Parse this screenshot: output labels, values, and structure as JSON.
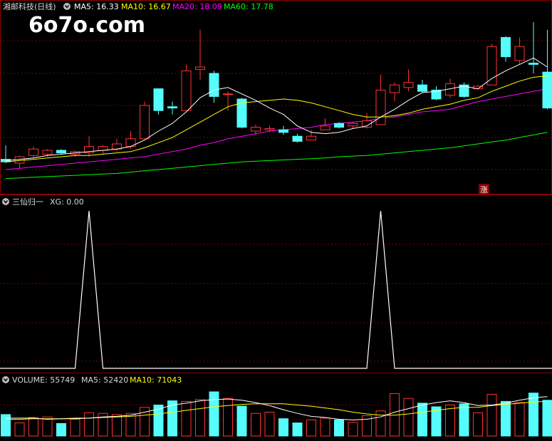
{
  "watermark": "6o7o.com",
  "colors": {
    "background": "#000000",
    "up": "#ff3232",
    "down": "#54fcfc",
    "ma5": "#ffffff",
    "ma10": "#ffff00",
    "ma20": "#ff00ff",
    "ma60": "#00ff00",
    "grid": "#7a0000",
    "label": "#d8d8d8",
    "signal": "#ffffff",
    "zhang_bg": "#8b0000"
  },
  "price_panel": {
    "title": "湘邮科技(日线)",
    "ma5_label": "MA5: 16.33",
    "ma10_label": "MA10: 16.67",
    "ma20_label": "MA20: 18.09",
    "ma60_label": "MA60: 17.78",
    "marker": "涨"
  },
  "signal_panel": {
    "title": "三仙归一",
    "xg_label": "XG: 0.00"
  },
  "volume_panel": {
    "volume_label": "VOLUME: 55749",
    "ma5_label": "MA5: 52420",
    "ma10_label": "MA10: 71043"
  },
  "chart_data": {
    "type": "candlestick",
    "candles": [
      {
        "o": 12.3,
        "h": 13.4,
        "l": 12.0,
        "c": 12.1
      },
      {
        "o": 12.0,
        "h": 12.6,
        "l": 11.6,
        "c": 12.5
      },
      {
        "o": 12.6,
        "h": 13.3,
        "l": 12.4,
        "c": 13.1
      },
      {
        "o": 12.7,
        "h": 13.1,
        "l": 12.5,
        "c": 13.0
      },
      {
        "o": 13.0,
        "h": 13.1,
        "l": 12.7,
        "c": 12.8
      },
      {
        "o": 12.7,
        "h": 13.0,
        "l": 12.5,
        "c": 12.9
      },
      {
        "o": 12.8,
        "h": 14.1,
        "l": 12.5,
        "c": 13.3
      },
      {
        "o": 13.0,
        "h": 13.4,
        "l": 12.7,
        "c": 13.3
      },
      {
        "o": 13.1,
        "h": 13.9,
        "l": 12.9,
        "c": 13.5
      },
      {
        "o": 13.3,
        "h": 14.5,
        "l": 13.1,
        "c": 13.9
      },
      {
        "o": 13.9,
        "h": 16.8,
        "l": 13.9,
        "c": 16.5
      },
      {
        "o": 17.8,
        "h": 17.8,
        "l": 15.8,
        "c": 16.1
      },
      {
        "o": 16.4,
        "h": 16.8,
        "l": 15.8,
        "c": 16.3
      },
      {
        "o": 16.1,
        "h": 19.7,
        "l": 16.1,
        "c": 19.2
      },
      {
        "o": 19.3,
        "h": 22.4,
        "l": 18.5,
        "c": 19.5
      },
      {
        "o": 19.0,
        "h": 19.2,
        "l": 16.7,
        "c": 17.2
      },
      {
        "o": 17.4,
        "h": 17.6,
        "l": 16.1,
        "c": 17.4
      },
      {
        "o": 17.0,
        "h": 17.1,
        "l": 14.7,
        "c": 14.8
      },
      {
        "o": 14.5,
        "h": 15.0,
        "l": 14.2,
        "c": 14.8
      },
      {
        "o": 14.6,
        "h": 14.9,
        "l": 14.4,
        "c": 14.7
      },
      {
        "o": 14.6,
        "h": 14.9,
        "l": 14.2,
        "c": 14.4
      },
      {
        "o": 14.1,
        "h": 14.3,
        "l": 13.6,
        "c": 13.7
      },
      {
        "o": 13.8,
        "h": 14.6,
        "l": 13.8,
        "c": 14.1
      },
      {
        "o": 14.6,
        "h": 15.5,
        "l": 14.6,
        "c": 14.9
      },
      {
        "o": 15.1,
        "h": 15.2,
        "l": 14.7,
        "c": 14.8
      },
      {
        "o": 14.9,
        "h": 15.2,
        "l": 14.7,
        "c": 15.1
      },
      {
        "o": 14.8,
        "h": 15.9,
        "l": 14.7,
        "c": 15.3
      },
      {
        "o": 15.0,
        "h": 18.9,
        "l": 15.0,
        "c": 17.7
      },
      {
        "o": 17.5,
        "h": 18.3,
        "l": 16.8,
        "c": 18.1
      },
      {
        "o": 17.9,
        "h": 19.3,
        "l": 17.6,
        "c": 18.3
      },
      {
        "o": 18.1,
        "h": 18.5,
        "l": 17.5,
        "c": 17.6
      },
      {
        "o": 17.7,
        "h": 18.0,
        "l": 16.9,
        "c": 17.0
      },
      {
        "o": 17.3,
        "h": 18.6,
        "l": 17.1,
        "c": 18.2
      },
      {
        "o": 18.1,
        "h": 18.3,
        "l": 17.1,
        "c": 17.2
      },
      {
        "o": 17.8,
        "h": 18.1,
        "l": 17.7,
        "c": 18.0
      },
      {
        "o": 18.1,
        "h": 21.3,
        "l": 18.1,
        "c": 21.1
      },
      {
        "o": 21.8,
        "h": 21.9,
        "l": 19.9,
        "c": 20.3
      },
      {
        "o": 20.0,
        "h": 21.8,
        "l": 19.7,
        "c": 21.1
      },
      {
        "o": 19.8,
        "h": 23.0,
        "l": 19.0,
        "c": 19.7
      },
      {
        "o": 19.1,
        "h": 22.4,
        "l": 16.2,
        "c": 16.3
      }
    ],
    "ma5": [
      12.2,
      12.3,
      12.4,
      12.6,
      12.7,
      12.8,
      12.9,
      13.0,
      13.1,
      13.3,
      13.8,
      14.5,
      15.1,
      16.0,
      17.1,
      17.7,
      17.9,
      17.4,
      16.9,
      16.3,
      15.8,
      14.9,
      14.4,
      14.3,
      14.4,
      14.7,
      14.9,
      15.6,
      16.2,
      16.9,
      17.5,
      17.6,
      17.8,
      18.0,
      17.8,
      18.6,
      19.2,
      19.7,
      20.2,
      19.5
    ],
    "ma10": [
      12.1,
      12.2,
      12.3,
      12.4,
      12.5,
      12.6,
      12.6,
      12.7,
      12.8,
      12.9,
      13.2,
      13.6,
      14.0,
      14.6,
      15.2,
      15.8,
      16.4,
      16.7,
      16.8,
      16.9,
      17.0,
      16.9,
      16.7,
      16.4,
      16.1,
      15.8,
      15.6,
      15.6,
      15.7,
      15.9,
      16.2,
      16.4,
      16.6,
      16.9,
      17.1,
      17.6,
      18.0,
      18.4,
      18.7,
      18.8
    ],
    "ma20": [
      11.5,
      11.6,
      11.7,
      11.8,
      11.9,
      12.0,
      12.1,
      12.2,
      12.3,
      12.4,
      12.5,
      12.7,
      12.9,
      13.1,
      13.4,
      13.6,
      13.9,
      14.1,
      14.3,
      14.5,
      14.6,
      14.7,
      14.8,
      15.0,
      15.1,
      15.2,
      15.3,
      15.5,
      15.6,
      15.8,
      16.0,
      16.1,
      16.2,
      16.5,
      16.8,
      17.0,
      17.2,
      17.4,
      17.6,
      17.8
    ],
    "ma60": [
      10.8,
      10.85,
      10.9,
      10.95,
      11.0,
      11.05,
      11.1,
      11.15,
      11.2,
      11.3,
      11.4,
      11.5,
      11.6,
      11.7,
      11.8,
      11.9,
      12.0,
      12.1,
      12.15,
      12.2,
      12.25,
      12.3,
      12.35,
      12.4,
      12.5,
      12.55,
      12.6,
      12.7,
      12.8,
      12.9,
      13.0,
      13.1,
      13.2,
      13.35,
      13.5,
      13.65,
      13.8,
      14.0,
      14.2,
      14.4
    ],
    "price_range": [
      10.0,
      23.5
    ],
    "signal": [
      0,
      0,
      0,
      0,
      0,
      0,
      1,
      0,
      0,
      0,
      0,
      0,
      0,
      0,
      0,
      0,
      0,
      0,
      0,
      0,
      0,
      0,
      0,
      0,
      0,
      0,
      0,
      1,
      0,
      0,
      0,
      0,
      0,
      0,
      0,
      0,
      0,
      0,
      0,
      0
    ],
    "signal_range": [
      0,
      1
    ],
    "volume": [
      36,
      22,
      31,
      32,
      21,
      28,
      39,
      38,
      36,
      38,
      48,
      52,
      59,
      58,
      61,
      74,
      63,
      50,
      38,
      40,
      29,
      22,
      27,
      30,
      27,
      23,
      34,
      42,
      71,
      63,
      55,
      49,
      52,
      54,
      39,
      70,
      58,
      56,
      72,
      60
    ],
    "vol_ma5": [
      30,
      30,
      30,
      28,
      29,
      29,
      30,
      32,
      33,
      35,
      40,
      45,
      52,
      55,
      59,
      61,
      62,
      60,
      56,
      51,
      44,
      38,
      33,
      31,
      28,
      27,
      28,
      32,
      40,
      46,
      52,
      56,
      59,
      56,
      51,
      52,
      55,
      60,
      64,
      66
    ],
    "vol_ma10": [
      28,
      28,
      29,
      29,
      29,
      30,
      30,
      31,
      32,
      33,
      35,
      37,
      40,
      43,
      46,
      49,
      51,
      53,
      54,
      54,
      54,
      52,
      50,
      47,
      44,
      40,
      37,
      35,
      35,
      37,
      40,
      43,
      46,
      48,
      48,
      51,
      53,
      55,
      57,
      58
    ],
    "volume_range": [
      0,
      80
    ]
  }
}
